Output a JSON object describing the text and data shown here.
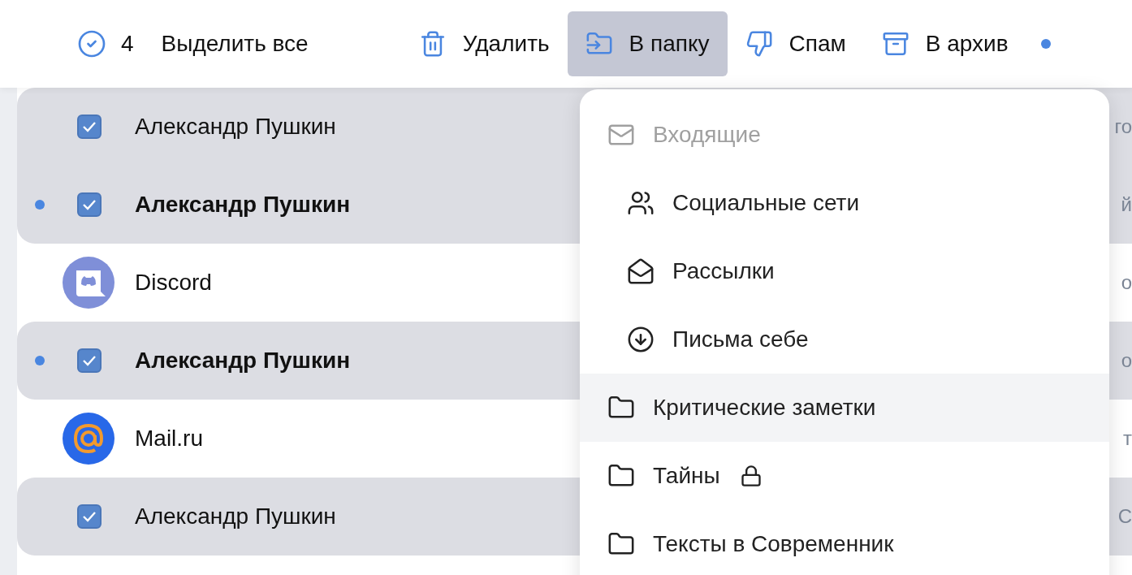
{
  "toolbar": {
    "selected_count": "4",
    "select_all": "Выделить все",
    "actions": [
      {
        "kind": "delete",
        "label": "Удалить",
        "active": false
      },
      {
        "kind": "move",
        "label": "В папку",
        "active": true
      },
      {
        "kind": "spam",
        "label": "Спам",
        "active": false
      },
      {
        "kind": "archive",
        "label": "В архив",
        "active": false
      }
    ],
    "more_dot": true
  },
  "messages": [
    {
      "selected": true,
      "unread": false,
      "sender": "Александр Пушкин",
      "snippet": "го"
    },
    {
      "selected": true,
      "unread": true,
      "sender": "Александр Пушкин",
      "snippet": "й"
    },
    {
      "selected": false,
      "unread": false,
      "sender": "Discord",
      "kind": "discord",
      "snippet": "о"
    },
    {
      "selected": true,
      "unread": true,
      "sender": "Александр Пушкин",
      "snippet": "о"
    },
    {
      "selected": false,
      "unread": false,
      "sender": "Mail.ru",
      "kind": "mailru",
      "snippet": "т"
    },
    {
      "selected": true,
      "unread": false,
      "sender": "Александр Пушкин",
      "snippet": "С"
    }
  ],
  "folder_menu": {
    "items": [
      {
        "kind": "inbox",
        "label": "Входящие",
        "disabled": true,
        "highlighted": false,
        "locked": false,
        "children": [
          {
            "kind": "social",
            "label": "Социальные сети",
            "disabled": false,
            "highlighted": false,
            "locked": false
          },
          {
            "kind": "newsletters",
            "label": "Рассылки",
            "disabled": false,
            "highlighted": false,
            "locked": false
          },
          {
            "kind": "self",
            "label": "Письма себе",
            "disabled": false,
            "highlighted": false,
            "locked": false
          }
        ]
      },
      {
        "kind": "folder",
        "label": "Критические заметки",
        "disabled": false,
        "highlighted": true,
        "locked": false
      },
      {
        "kind": "folder",
        "label": "Тайны",
        "disabled": false,
        "highlighted": false,
        "locked": true
      },
      {
        "kind": "folder",
        "label": "Тексты в Современник",
        "disabled": false,
        "highlighted": false,
        "locked": false
      }
    ]
  }
}
